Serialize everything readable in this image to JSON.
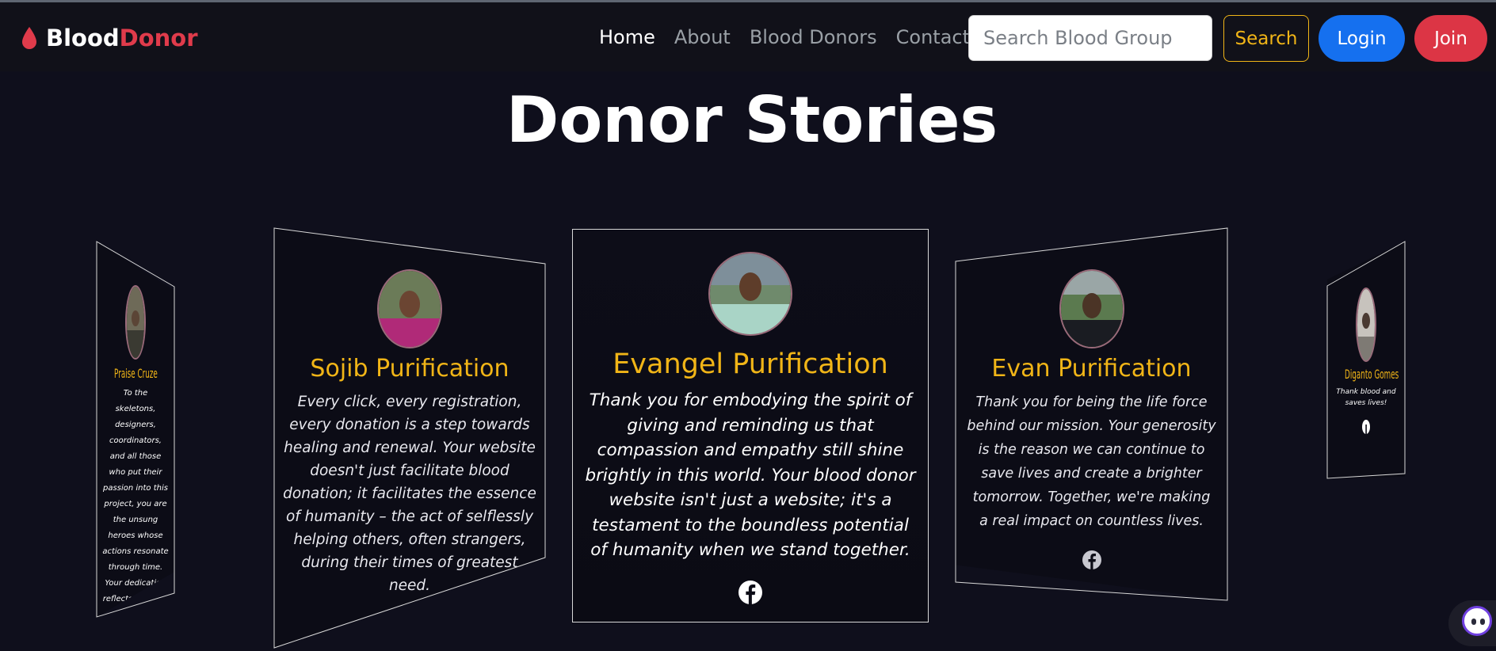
{
  "brand": {
    "part1": "Blood",
    "part2": "Donor",
    "icon": "blood-drop-icon",
    "accent_color": "#e03b4b"
  },
  "nav": {
    "items": [
      {
        "label": "Home",
        "active": true
      },
      {
        "label": "About",
        "active": false
      },
      {
        "label": "Blood Donors",
        "active": false
      },
      {
        "label": "Contact",
        "active": false
      }
    ],
    "search_placeholder": "Search Blood Group",
    "search_label": "Search",
    "login_label": "Login",
    "join_label": "Join"
  },
  "page": {
    "title": "Donor Stories"
  },
  "stories": {
    "far_left": {
      "name": "Praise Cruze",
      "quote": "To the skeletons, designers, coordinators, and all those who put their passion into this project, you are the unsung heroes whose actions resonate through time. Your dedication reflects the light in the world where kindness ever counts.",
      "social_icon": "facebook-icon"
    },
    "left": {
      "name": "Sojib Purification",
      "quote": "Every click, every registration, every donation is a step towards healing and renewal. Your website doesn't just facilitate blood donation; it facilitates the essence of humanity – the act of selflessly helping others, often strangers, during their times of greatest need.",
      "social_icon": "facebook-icon"
    },
    "center": {
      "name": "Evangel Purification",
      "quote": "Thank you for embodying the spirit of giving and reminding us that compassion and empathy still shine brightly in this world. Your blood donor website isn't just a website; it's a testament to the boundless potential of humanity when we stand together.",
      "social_icon": "facebook-icon"
    },
    "right": {
      "name": "Evan Purification",
      "quote": "Thank you for being the life force behind our mission. Your generosity is the reason we can continue to save lives and create a brighter tomorrow. Together, we're making a real impact on countless lives.",
      "social_icon": "facebook-icon"
    },
    "far_right": {
      "name": "Diganto Gomes",
      "quote": "Thank blood and saves lives!",
      "social_icon": "facebook-icon"
    }
  },
  "chat_widget": {
    "icon": "chat-assistant-icon"
  },
  "colors": {
    "background": "#0f0f1c",
    "navbar": "#111119",
    "accent_yellow": "#f1b517",
    "login_blue": "#1570ef",
    "join_red": "#dc3545"
  }
}
